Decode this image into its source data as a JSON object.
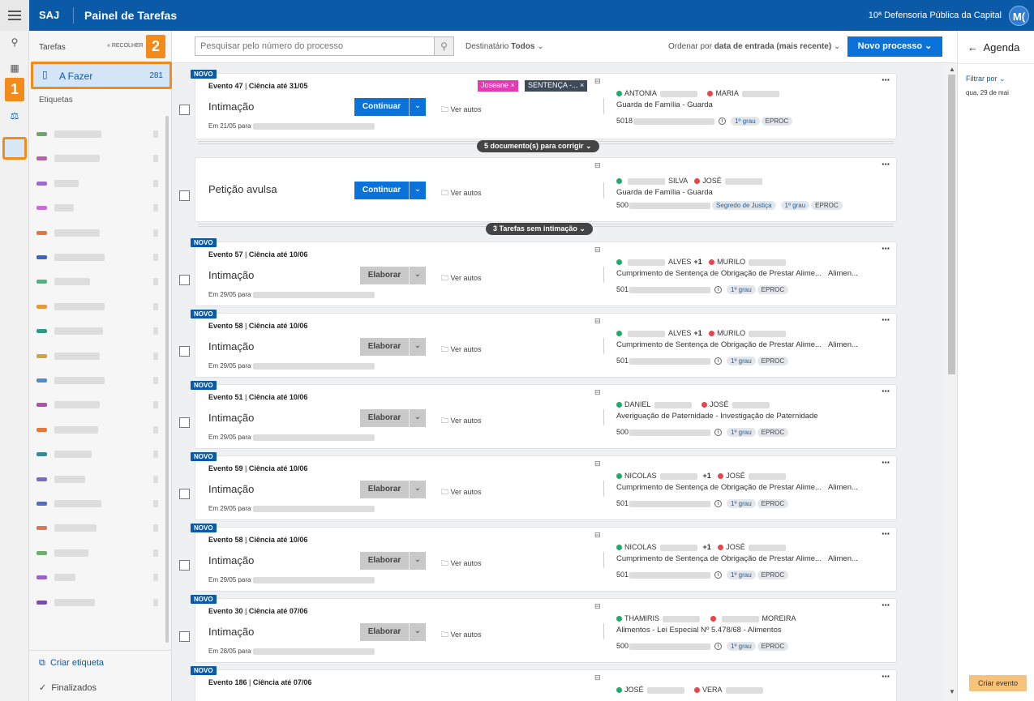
{
  "header": {
    "brand": "SAJ",
    "title": "Painel de Tarefas",
    "org": "10ª Defensoria Pública da Capital",
    "avatar": "M("
  },
  "annotations": {
    "badge1": "1",
    "badge2": "2"
  },
  "sidebar": {
    "title": "Tarefas",
    "collapse": "« RECOLHER",
    "todo": {
      "label": "A Fazer",
      "count": "281"
    },
    "labels_header": "Etiquetas",
    "tag_colors": [
      "#6aa86b",
      "#c35aa6",
      "#9c6bcf",
      "#c86fd6",
      "#e07a3a",
      "#3a66c0",
      "#4db57d",
      "#e39a3a",
      "#2d9c86",
      "#c8a640",
      "#4b8cd6",
      "#b44fae",
      "#e37a3a",
      "#3a8a94",
      "#7b6ac8",
      "#4f6ec9",
      "#d77a57",
      "#6cb06b",
      "#9b63c9",
      "#7d4bb8"
    ],
    "footer": {
      "create": "Criar etiqueta",
      "done": "Finalizados"
    }
  },
  "toolbar": {
    "search_placeholder": "Pesquisar pelo número do processo",
    "dest_label": "Destinatário",
    "dest_value": "Todos",
    "order_label": "Ordenar por",
    "order_value": "data de entrada (mais recente)",
    "new_process": "Novo processo"
  },
  "cards": [
    {
      "evento": "Evento 47",
      "ciencia": "Ciência até 31/05",
      "kind": "Intimação",
      "date": "Em 21/05 para",
      "action": "Continuar",
      "ver": "Ver autos",
      "p1": "ANTONIA",
      "p2": "MARIA",
      "subject": "Guarda de Família - Guarda",
      "proc": "5018",
      "grau": "1º grau",
      "eproc": "EPROC",
      "chip1": "Joseane",
      "chip2": "SENTENÇA -...",
      "pager": "5 documento(s) para corrigir"
    },
    {
      "kind": "Petição avulsa",
      "action": "Continuar",
      "ver": "Ver autos",
      "p1b": "SILVA",
      "p2": "JOSÉ",
      "subject": "Guarda de Família - Guarda",
      "proc": "500",
      "segredo": "Segredo de Justiça",
      "grau": "1º grau",
      "eproc": "EPROC",
      "pager": "3 Tarefas sem intimação"
    },
    {
      "evento": "Evento 57",
      "ciencia": "Ciência até 10/06",
      "kind": "Intimação",
      "date": "Em 29/05 para",
      "action": "Elaborar",
      "ver": "Ver autos",
      "p1b": "ALVES",
      "p1c": "+1",
      "p2": "MURILO",
      "subject": "Cumprimento de Sentença de Obrigação de Prestar Alime...",
      "subject2": "Alimen...",
      "proc": "501",
      "grau": "1º grau",
      "eproc": "EPROC"
    },
    {
      "evento": "Evento 58",
      "ciencia": "Ciência até 10/06",
      "kind": "Intimação",
      "date": "Em 29/05 para",
      "action": "Elaborar",
      "ver": "Ver autos",
      "p1b": "ALVES",
      "p1c": "+1",
      "p2": "MURILO",
      "subject": "Cumprimento de Sentença de Obrigação de Prestar Alime...",
      "subject2": "Alimen...",
      "proc": "501",
      "grau": "1º grau",
      "eproc": "EPROC"
    },
    {
      "evento": "Evento 51",
      "ciencia": "Ciência até 10/06",
      "kind": "Intimação",
      "date": "Em 29/05 para",
      "action": "Elaborar",
      "ver": "Ver autos",
      "p1": "DANIEL",
      "p2": "JOSÉ",
      "subject": "Averiguação de Paternidade - Investigação de Paternidade",
      "proc": "500",
      "grau": "1º grau",
      "eproc": "EPROC"
    },
    {
      "evento": "Evento 59",
      "ciencia": "Ciência até 10/06",
      "kind": "Intimação",
      "date": "Em 29/05 para",
      "action": "Elaborar",
      "ver": "Ver autos",
      "p1": "NICOLAS",
      "p1c": "+1",
      "p2": "JOSÉ",
      "subject": "Cumprimento de Sentença de Obrigação de Prestar Alime...",
      "subject2": "Alimen...",
      "proc": "501",
      "grau": "1º grau",
      "eproc": "EPROC"
    },
    {
      "evento": "Evento 58",
      "ciencia": "Ciência até 10/06",
      "kind": "Intimação",
      "date": "Em 29/05 para",
      "action": "Elaborar",
      "ver": "Ver autos",
      "p1": "NICOLAS",
      "p1c": "+1",
      "p2": "JOSÉ",
      "subject": "Cumprimento de Sentença de Obrigação de Prestar Alime...",
      "subject2": "Alimen...",
      "proc": "501",
      "grau": "1º grau",
      "eproc": "EPROC"
    },
    {
      "evento": "Evento 30",
      "ciencia": "Ciência até 07/06",
      "kind": "Intimação",
      "date": "Em 28/05 para",
      "action": "Elaborar",
      "ver": "Ver autos",
      "p1": "THAMIRIS",
      "p2b": "MOREIRA",
      "subject": "Alimentos - Lei Especial Nº 5.478/68 - Alimentos",
      "proc": "500",
      "grau": "1º grau",
      "eproc": "EPROC"
    },
    {
      "evento": "Evento 186",
      "ciencia": "Ciência até 07/06",
      "p1": "JOSÉ",
      "p2": "VERA"
    }
  ],
  "novo": "NOVO",
  "agenda": {
    "title": "Agenda",
    "filter": "Filtrar por",
    "date": "qua, 29 de mai",
    "create": "Criar evento"
  }
}
